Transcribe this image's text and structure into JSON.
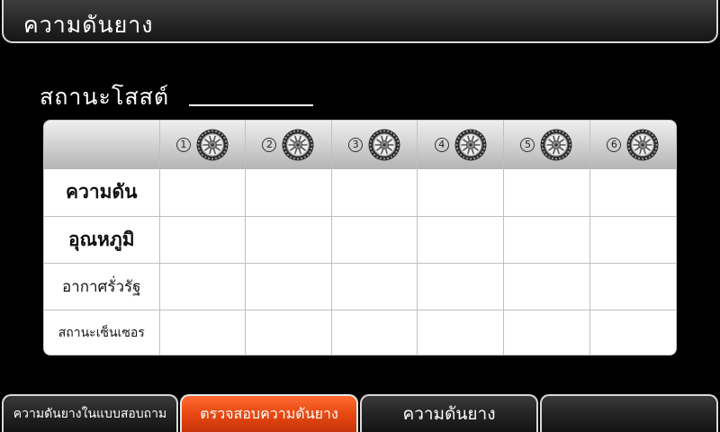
{
  "title": "ความดันยาง",
  "status": {
    "label": "สถานะโสสต์"
  },
  "table": {
    "tires": [
      {
        "number": "1",
        "icon": "tire-icon"
      },
      {
        "number": "2",
        "icon": "tire-icon"
      },
      {
        "number": "3",
        "icon": "tire-icon"
      },
      {
        "number": "4",
        "icon": "tire-icon"
      },
      {
        "number": "5",
        "icon": "tire-icon"
      },
      {
        "number": "6",
        "icon": "tire-icon"
      }
    ],
    "rows": [
      {
        "label": "ความดัน"
      },
      {
        "label": "อุณหภูมิ"
      },
      {
        "label": "อากาศรั่วรัฐ"
      },
      {
        "label": "สถานะเซ็นเซอร"
      }
    ]
  },
  "tabs": [
    {
      "label": "ความดันยางในแบบสอบถาม",
      "active": false
    },
    {
      "label": "ตรวจสอบความดันยาง",
      "active": true
    },
    {
      "label": "ความดันยาง",
      "active": false
    },
    {
      "label": "",
      "active": false
    }
  ],
  "colors": {
    "active_tab": "#e84812",
    "background": "#000000",
    "table_header": "#cfcfcf"
  }
}
